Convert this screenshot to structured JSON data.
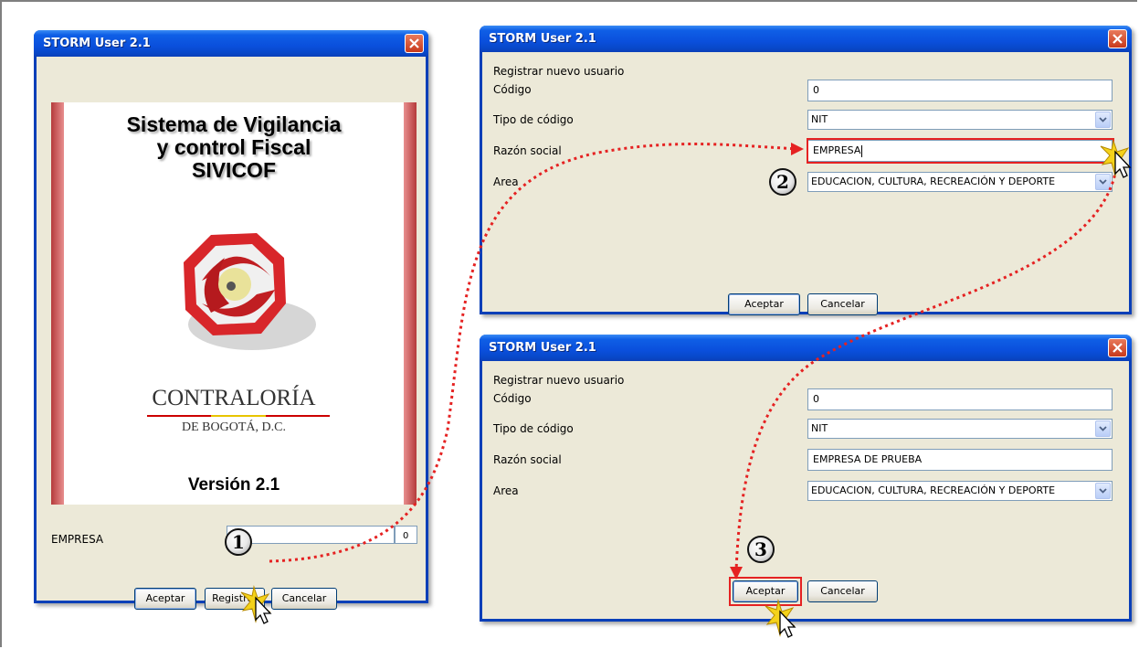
{
  "login_window": {
    "title": "STORM User 2.1",
    "splash": {
      "heading_line1": "Sistema de Vigilancia",
      "heading_line2": "y control Fiscal",
      "heading_line3": "SIVICOF",
      "org_name": "CONTRALORÍA",
      "org_sub": "DE BOGOTÁ, D.C.",
      "version": "Versión 2.1"
    },
    "empresa_label": "EMPRESA",
    "empresa_value": "",
    "empresa_code": "0",
    "buttons": {
      "accept": "Aceptar",
      "register": "Registrar",
      "cancel": "Cancelar"
    }
  },
  "register_window_top": {
    "title": "STORM User 2.1",
    "heading": "Registrar nuevo usuario",
    "labels": {
      "codigo": "Código",
      "tipo": "Tipo de código",
      "razon": "Razón social",
      "area": "Area"
    },
    "values": {
      "codigo": "0",
      "tipo": "NIT",
      "razon": "EMPRESA",
      "area": "EDUCACION, CULTURA, RECREACIÓN Y DEPORTE"
    },
    "buttons": {
      "accept": "Aceptar",
      "cancel": "Cancelar"
    }
  },
  "register_window_bottom": {
    "title": "STORM User 2.1",
    "heading": "Registrar nuevo usuario",
    "labels": {
      "codigo": "Código",
      "tipo": "Tipo de código",
      "razon": "Razón social",
      "area": "Area"
    },
    "values": {
      "codigo": "0",
      "tipo": "NIT",
      "razon": "EMPRESA DE PRUEBA",
      "area": "EDUCACION, CULTURA, RECREACIÓN Y DEPORTE"
    },
    "buttons": {
      "accept": "Aceptar",
      "cancel": "Cancelar"
    }
  },
  "steps": {
    "one": "1",
    "two": "2",
    "three": "3"
  },
  "colors": {
    "title_blue": "#0a4fdc",
    "highlight_red": "#e52222",
    "window_bg": "#ece9d8"
  }
}
